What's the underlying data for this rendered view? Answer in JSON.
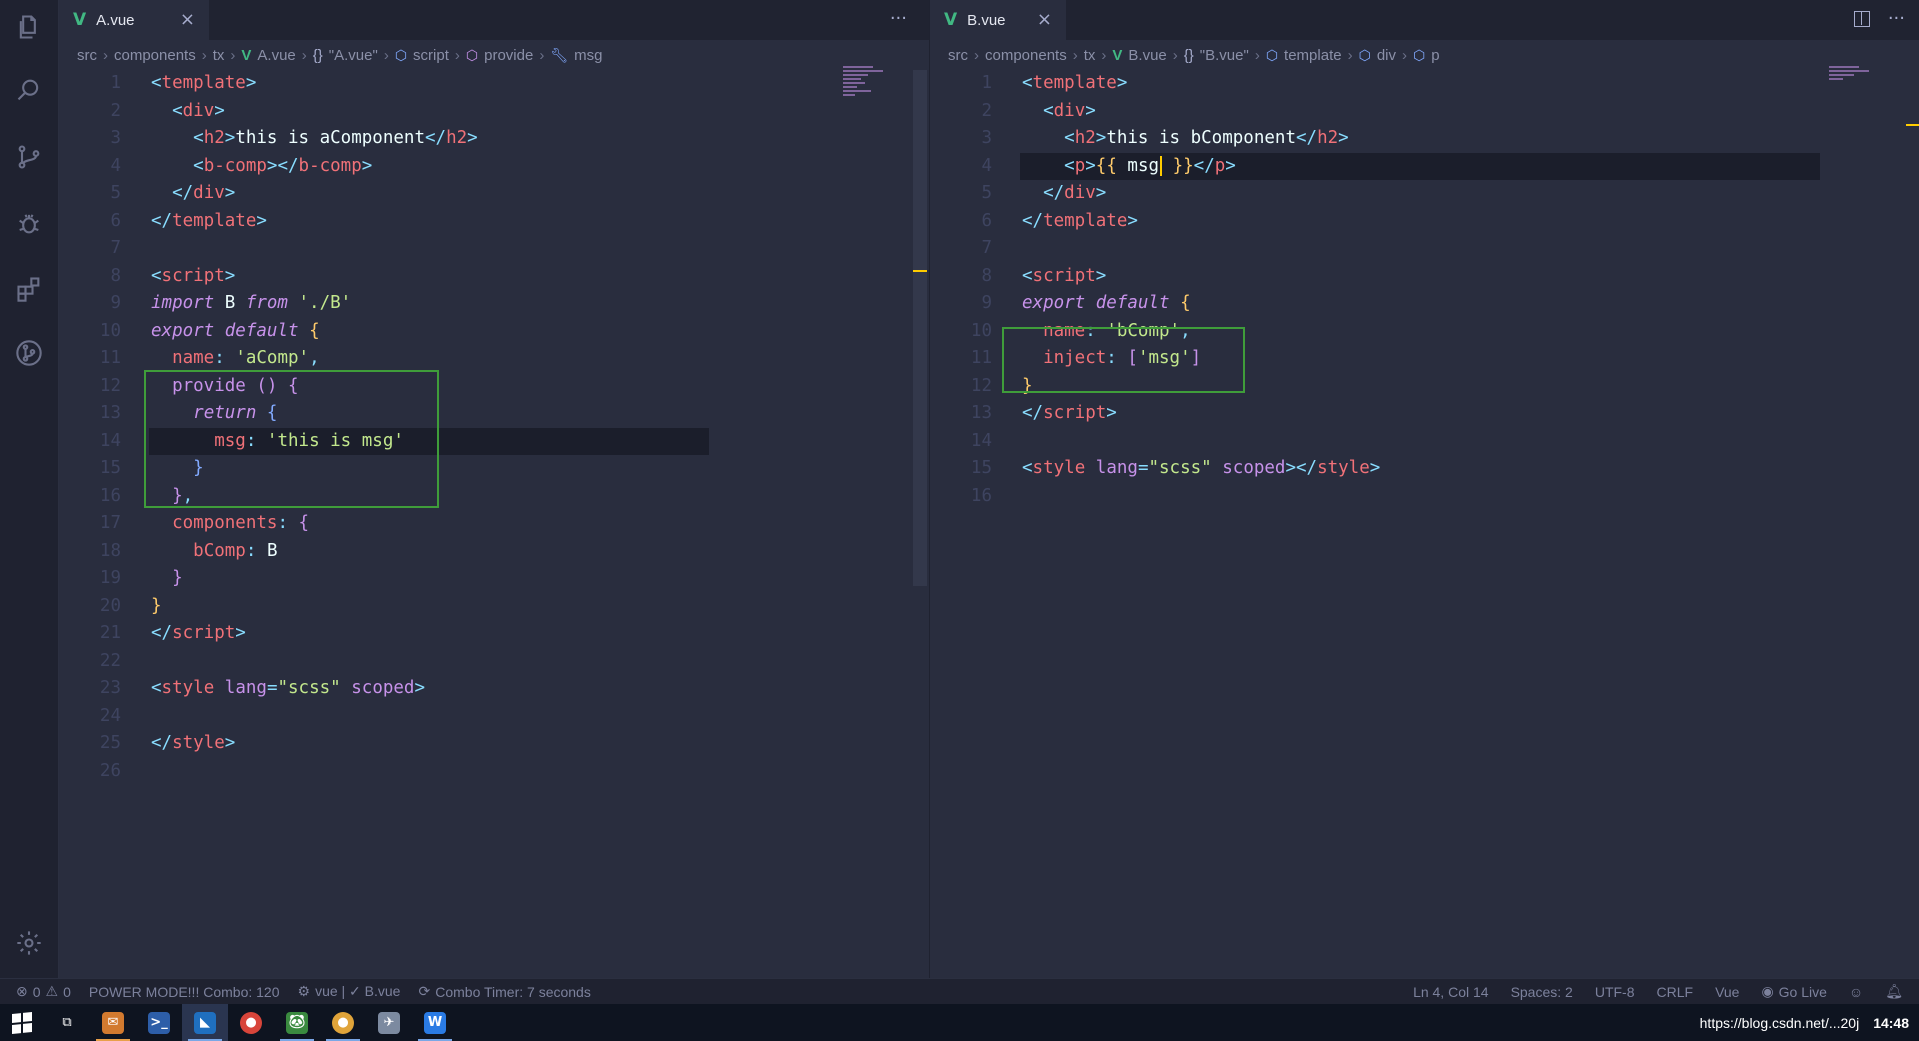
{
  "left_editor": {
    "tab": {
      "icon": "vue-icon",
      "label": "A.vue"
    },
    "breadcrumb": [
      "src",
      "components",
      "tx",
      "A.vue",
      "\"A.vue\"",
      "script",
      "provide",
      "msg"
    ],
    "lines": [
      {
        "n": "1"
      },
      {
        "n": "2"
      },
      {
        "n": "3"
      },
      {
        "n": "4"
      },
      {
        "n": "5"
      },
      {
        "n": "6"
      },
      {
        "n": "7"
      },
      {
        "n": "8"
      },
      {
        "n": "9"
      },
      {
        "n": "10"
      },
      {
        "n": "11"
      },
      {
        "n": "12"
      },
      {
        "n": "13"
      },
      {
        "n": "14"
      },
      {
        "n": "15"
      },
      {
        "n": "16"
      },
      {
        "n": "17"
      },
      {
        "n": "18"
      },
      {
        "n": "19"
      },
      {
        "n": "20"
      },
      {
        "n": "21"
      },
      {
        "n": "22"
      },
      {
        "n": "23"
      },
      {
        "n": "24"
      },
      {
        "n": "25"
      },
      {
        "n": "26"
      }
    ],
    "code": {
      "l1": "template",
      "l2": "div",
      "l3_text": "this is aComponent",
      "l3_tag": "h2",
      "l4_tag": "b-comp",
      "l5": "div",
      "l6": "template",
      "l8": "script",
      "l9_kw1": "import",
      "l9_id": " B ",
      "l9_kw2": "from",
      "l9_str": " './B'",
      "l10_kw": "export default",
      "l11_prop": "name",
      "l11_str": "'aComp'",
      "l12_prop": "provide",
      "l13_kw": "return",
      "l14_prop": "msg",
      "l14_str": "'this is msg'",
      "l17_prop": "components",
      "l18_prop": "bComp",
      "l18_val": "B",
      "l21": "script",
      "l23_tag": "style",
      "l23_attr1": "lang",
      "l23_val": "\"scss\"",
      "l23_attr2": "scoped",
      "l25": "style"
    }
  },
  "right_editor": {
    "tab": {
      "icon": "vue-icon",
      "label": "B.vue"
    },
    "breadcrumb": [
      "src",
      "components",
      "tx",
      "B.vue",
      "\"B.vue\"",
      "template",
      "div",
      "p"
    ],
    "lines": [
      {
        "n": "1"
      },
      {
        "n": "2"
      },
      {
        "n": "3"
      },
      {
        "n": "4"
      },
      {
        "n": "5"
      },
      {
        "n": "6"
      },
      {
        "n": "7"
      },
      {
        "n": "8"
      },
      {
        "n": "9"
      },
      {
        "n": "10"
      },
      {
        "n": "11"
      },
      {
        "n": "12"
      },
      {
        "n": "13"
      },
      {
        "n": "14"
      },
      {
        "n": "15"
      },
      {
        "n": "16"
      }
    ],
    "code": {
      "l1": "template",
      "l2": "div",
      "l3_text": "this is bComponent",
      "l3_tag": "h2",
      "l4_tag": "p",
      "l4_expr": "msg",
      "l5": "div",
      "l6": "template",
      "l8": "script",
      "l9_kw": "export default",
      "l10_prop": "name",
      "l10_str": "'bComp'",
      "l11_prop": "inject",
      "l11_str": "'msg'",
      "l13": "script",
      "l15_tag": "style",
      "l15_attr1": "lang",
      "l15_val": "\"scss\"",
      "l15_attr2": "scoped"
    }
  },
  "statusbar": {
    "errors": "0",
    "warnings": "0",
    "power_mode": "POWER MODE!!! Combo: 120",
    "vue_status": "vue | ✓ B.vue",
    "combo_timer": "Combo Timer: 7 seconds",
    "position": "Ln 4, Col 14",
    "spaces": "Spaces: 2",
    "encoding": "UTF-8",
    "eol": "CRLF",
    "language": "Vue",
    "go_live": "Go Live"
  },
  "taskbar": {
    "tray_text": "https://blog.csdn.net/...20j",
    "time": "14:48"
  },
  "colors": {
    "accent_green": "#3f9d3a",
    "cursor_yellow": "#ffcc00",
    "vue_green": "#41b883"
  }
}
